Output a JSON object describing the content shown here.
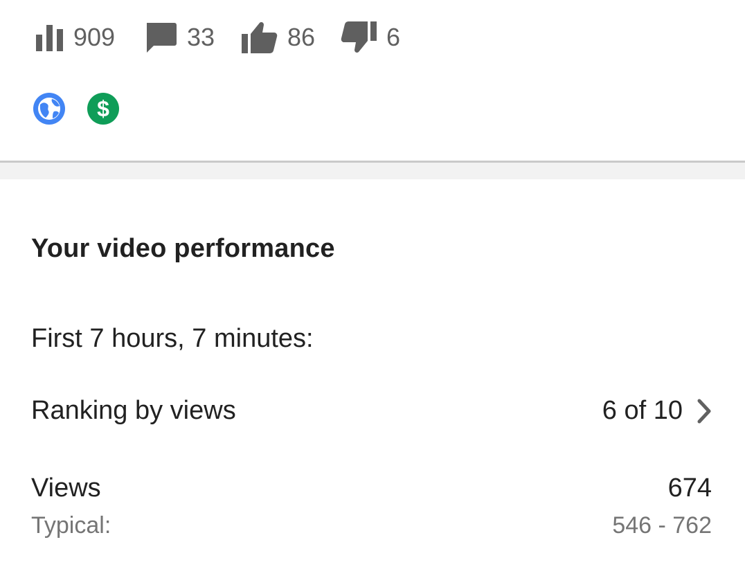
{
  "stats": {
    "views": "909",
    "comments": "33",
    "likes": "86",
    "dislikes": "6"
  },
  "icons": {
    "views": "bar-chart-icon",
    "comments": "comment-icon",
    "likes": "thumbs-up-icon",
    "dislikes": "thumbs-down-icon",
    "visibility": "globe-icon",
    "monetization": "dollar-icon"
  },
  "colors": {
    "stat_icon": "#5f5f5f",
    "globe_badge": "#4285f4",
    "dollar_badge": "#0f9d58",
    "text_primary": "#212121",
    "text_secondary": "#757575"
  },
  "performance": {
    "title": "Your video performance",
    "period": "First 7 hours, 7 minutes:",
    "ranking_label": "Ranking by views",
    "ranking_value": "6 of 10",
    "views_label": "Views",
    "views_value": "674",
    "typical_label": "Typical:",
    "typical_value": "546 - 762"
  }
}
